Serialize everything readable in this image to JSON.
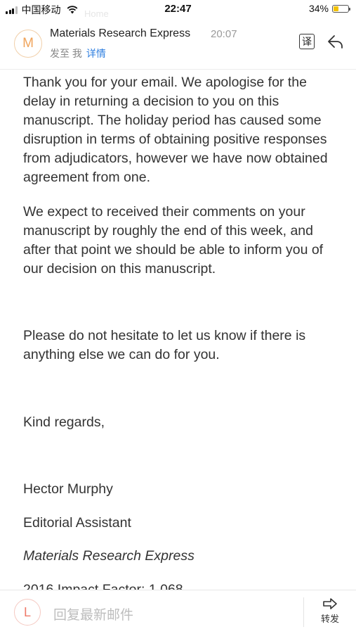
{
  "status_bar": {
    "carrier": "中国移动",
    "time": "22:47",
    "battery_percent": "34%",
    "battery_level": 0.34,
    "ghost_text": "Home"
  },
  "header": {
    "avatar_letter": "M",
    "sender": "Materials Research Express",
    "time": "20:07",
    "recipient": "发至 我",
    "details_link": "详情",
    "translate_icon": "译"
  },
  "body": {
    "p1": "Thank you for your email. We apologise for the delay in returning a decision to you on this manuscript. The holiday period has caused some disruption in terms of obtaining positive responses from adjudicators, however we have now obtained agreement from one.",
    "p2": "We expect to received their comments on your manuscript by roughly the end of this week, and after that point we should be able to inform you of our decision on this manuscript.",
    "p3": "Please do not hesitate to let us know if there is anything else we can do for you.",
    "p4": "Kind regards,",
    "p5": "Hector Murphy",
    "p6": "Editorial Assistant",
    "p7": "Materials Research Express",
    "p8": "2016 Impact Factor: 1.068"
  },
  "bottom_bar": {
    "avatar_letter": "L",
    "reply_placeholder": "回复最新邮件",
    "forward_label": "转发"
  },
  "colors": {
    "link": "#2f7fe0",
    "avatar_m": "#f0a45b",
    "avatar_l": "#ef7a6a",
    "battery": "#f2c200"
  }
}
